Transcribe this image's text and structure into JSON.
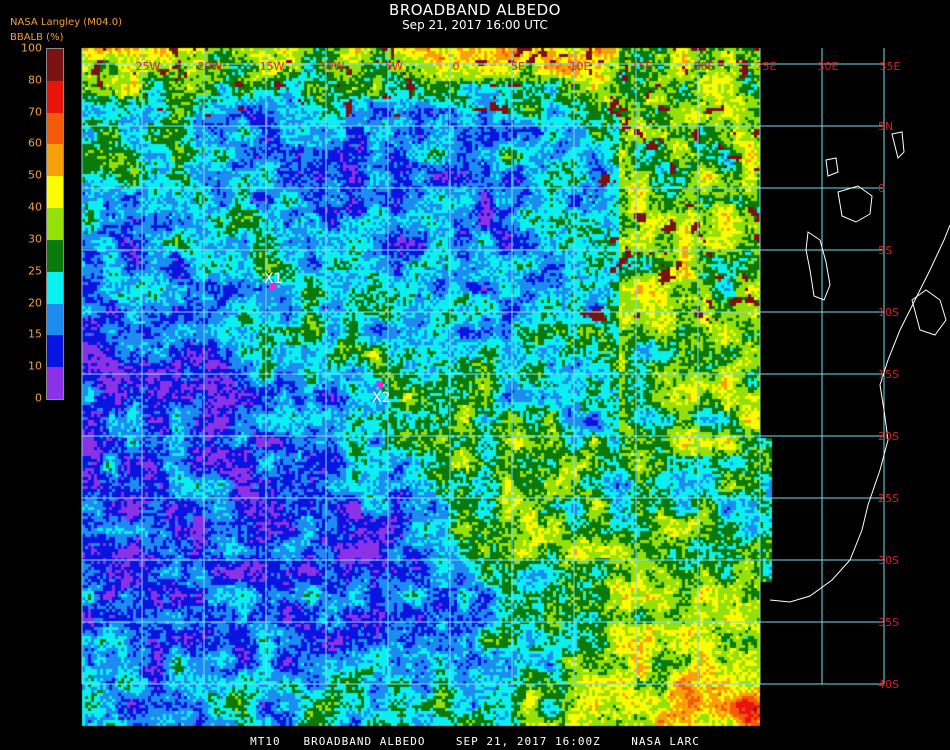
{
  "header": {
    "title": "BROADBAND ALBEDO",
    "datetime": "Sep 21, 2017 16:00 UTC",
    "org": "NASA Langley (M04.0)",
    "units_label": "BBALB (%)"
  },
  "colorbar": {
    "ticks": [
      "100",
      "80",
      "70",
      "60",
      "50",
      "40",
      "30",
      "25",
      "20",
      "15",
      "10",
      "0"
    ],
    "bins": [
      {
        "range": "80-100",
        "color": "#7a1212"
      },
      {
        "range": "70-80",
        "color": "#e8140c"
      },
      {
        "range": "60-70",
        "color": "#f45a0a"
      },
      {
        "range": "50-60",
        "color": "#f8a00a"
      },
      {
        "range": "40-50",
        "color": "#fcfc00"
      },
      {
        "range": "30-40",
        "color": "#96e00a"
      },
      {
        "range": "25-30",
        "color": "#0a7a0a"
      },
      {
        "range": "20-25",
        "color": "#0af0f0"
      },
      {
        "range": "15-20",
        "color": "#1c8cf0"
      },
      {
        "range": "10-15",
        "color": "#0a14e0"
      },
      {
        "range": "0-10",
        "color": "#8c32e6"
      }
    ]
  },
  "map": {
    "lon_labels": [
      "25W",
      "20W",
      "15W",
      "10W",
      "5W",
      "0",
      "5E",
      "10E",
      "15E",
      "20E",
      "25E",
      "30E",
      "35E"
    ],
    "lat_labels": [
      "5N",
      "0",
      "5S",
      "10S",
      "15S",
      "20S",
      "25S",
      "30S",
      "35S",
      "40S"
    ],
    "markers": [
      {
        "label": "X1",
        "lon": "-14.5",
        "lat": "-8"
      },
      {
        "label": "X2",
        "lon": "-5.5",
        "lat": "-15.5"
      }
    ],
    "grid_color": "#7adcf0",
    "label_color": "#dc1e1e",
    "coast_color": "#ffffff"
  },
  "footer": {
    "text": "MT10   BROADBAND ALBEDO    SEP 21, 2017 16:00Z    NASA LARC"
  }
}
